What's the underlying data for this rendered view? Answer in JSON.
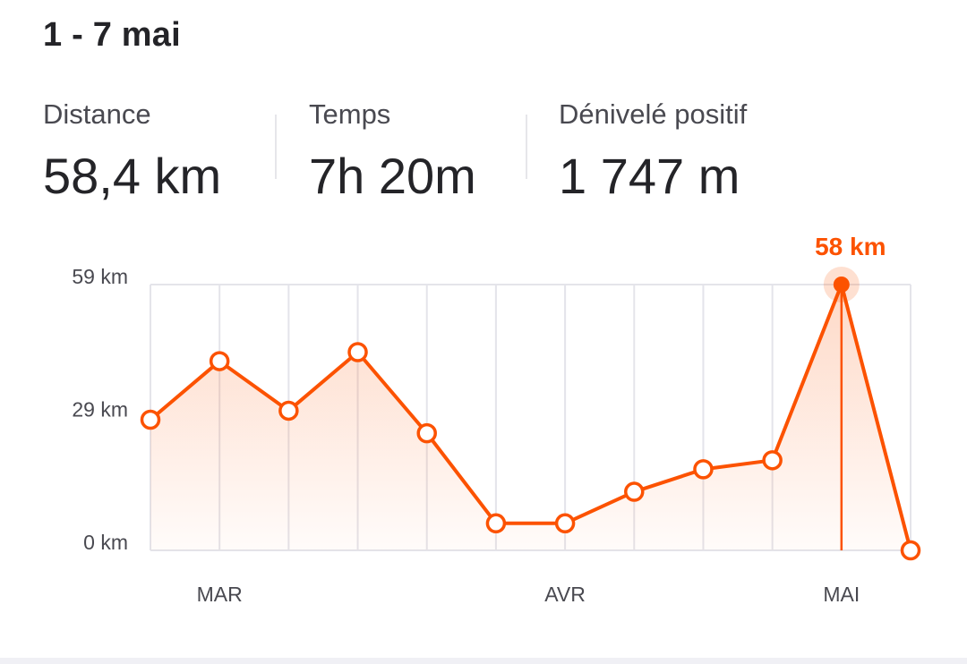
{
  "summary": {
    "period": "1 - 7 mai",
    "stats": [
      {
        "label": "Distance",
        "value": "58,4 km"
      },
      {
        "label": "Temps",
        "value": "7h 20m"
      },
      {
        "label": "Dénivelé positif",
        "value": "1 747 m"
      }
    ]
  },
  "colors": {
    "accent": "#fc5200",
    "grid": "#e4e4ea",
    "axis_text": "#494950"
  },
  "chart_data": {
    "type": "line",
    "x": [
      "",
      "MAR",
      "",
      "",
      "",
      "",
      "AVR",
      "",
      "",
      "",
      "MAI",
      ""
    ],
    "values": [
      29,
      42,
      31,
      44,
      26,
      6,
      6,
      13,
      18,
      20,
      59,
      0
    ],
    "y_ticks": [
      "0 km",
      "29 km",
      "59 km"
    ],
    "ylim": [
      0,
      59
    ],
    "x_tick_labels": [
      "MAR",
      "AVR",
      "MAI"
    ],
    "highlight": {
      "index": 10,
      "label": "58 km"
    },
    "grid": true
  }
}
